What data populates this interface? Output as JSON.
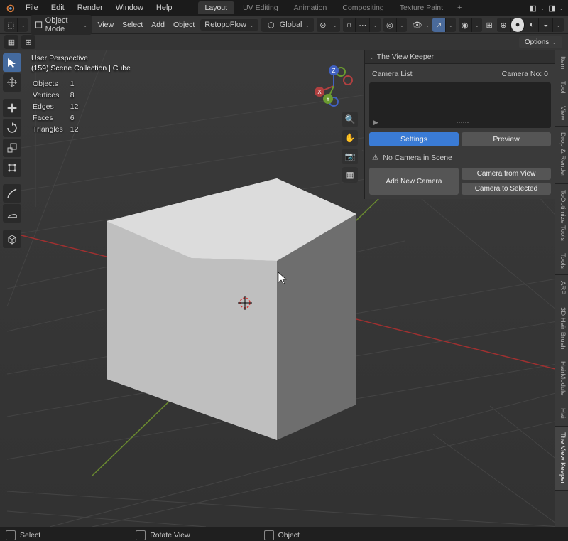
{
  "menus": {
    "file": "File",
    "edit": "Edit",
    "render": "Render",
    "window": "Window",
    "help": "Help"
  },
  "workspaces": {
    "layout": "Layout",
    "uv": "UV Editing",
    "anim": "Animation",
    "comp": "Compositing",
    "tex": "Texture Paint"
  },
  "toolbar": {
    "mode": "Object Mode",
    "view": "View",
    "select": "Select",
    "add": "Add",
    "object": "Object",
    "retopo": "RetopoFlow",
    "global": "Global",
    "options": "Options"
  },
  "overlay": {
    "persp": "User Perspective",
    "collection": "(159) Scene Collection | Cube",
    "stats": [
      {
        "k": "Objects",
        "v": "1"
      },
      {
        "k": "Vertices",
        "v": "8"
      },
      {
        "k": "Edges",
        "v": "12"
      },
      {
        "k": "Faces",
        "v": "6"
      },
      {
        "k": "Triangles",
        "v": "12"
      }
    ]
  },
  "axes": {
    "x": "X",
    "y": "Y",
    "z": "Z"
  },
  "panel": {
    "title": "The View Keeper",
    "cam_list": "Camera List",
    "cam_no_label": "Camera No:",
    "cam_no": "0",
    "settings": "Settings",
    "preview": "Preview",
    "no_cam": "No Camera in Scene",
    "add_new": "Add New Camera",
    "from_view": "Camera from View",
    "to_selected": "Camera to Selected",
    "play": "▶",
    "dots": "⋯⋯"
  },
  "tabs": [
    "Item",
    "Tool",
    "View",
    "Drop & Render",
    "ToOptimize Tools",
    "Tools",
    "ARP",
    "3D Hair Brush",
    "HairModule",
    "Hair",
    "The View Keeper"
  ],
  "status": {
    "select": "Select",
    "rotate": "Rotate View",
    "object": "Object"
  }
}
